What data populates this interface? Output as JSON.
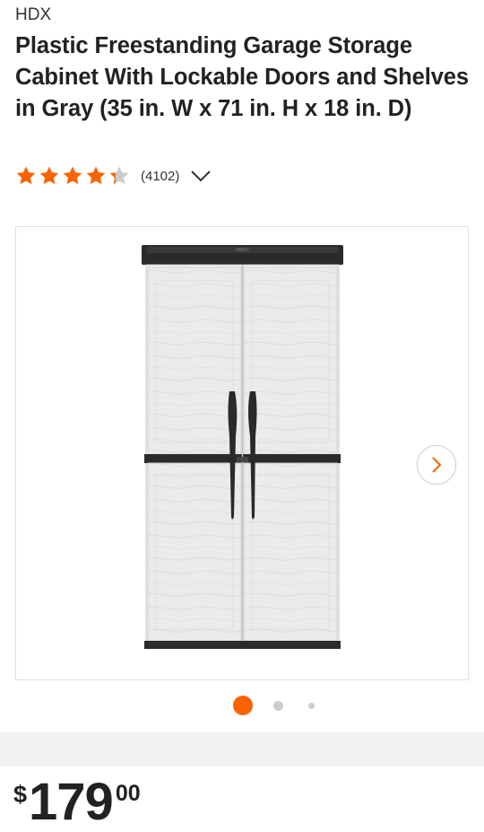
{
  "product": {
    "brand": "HDX",
    "title": "Plastic Freestanding Garage Storage Cabinet With Lockable Doors and Shelves in Gray (35 in. W x 71 in. H x 18 in. D)"
  },
  "rating": {
    "stars": 4.3,
    "max_stars": 5,
    "review_count": "(4102)"
  },
  "gallery": {
    "image_count": 3,
    "active_index": 0
  },
  "price": {
    "currency": "$",
    "whole": "179",
    "cents": "00"
  },
  "colors": {
    "accent": "#f96302",
    "star_empty": "#cccccc",
    "text": "#222222",
    "band": "#f2f2f2"
  },
  "icons": {
    "rating_toggle": "chevron-down-icon",
    "next": "chevron-right-icon"
  }
}
